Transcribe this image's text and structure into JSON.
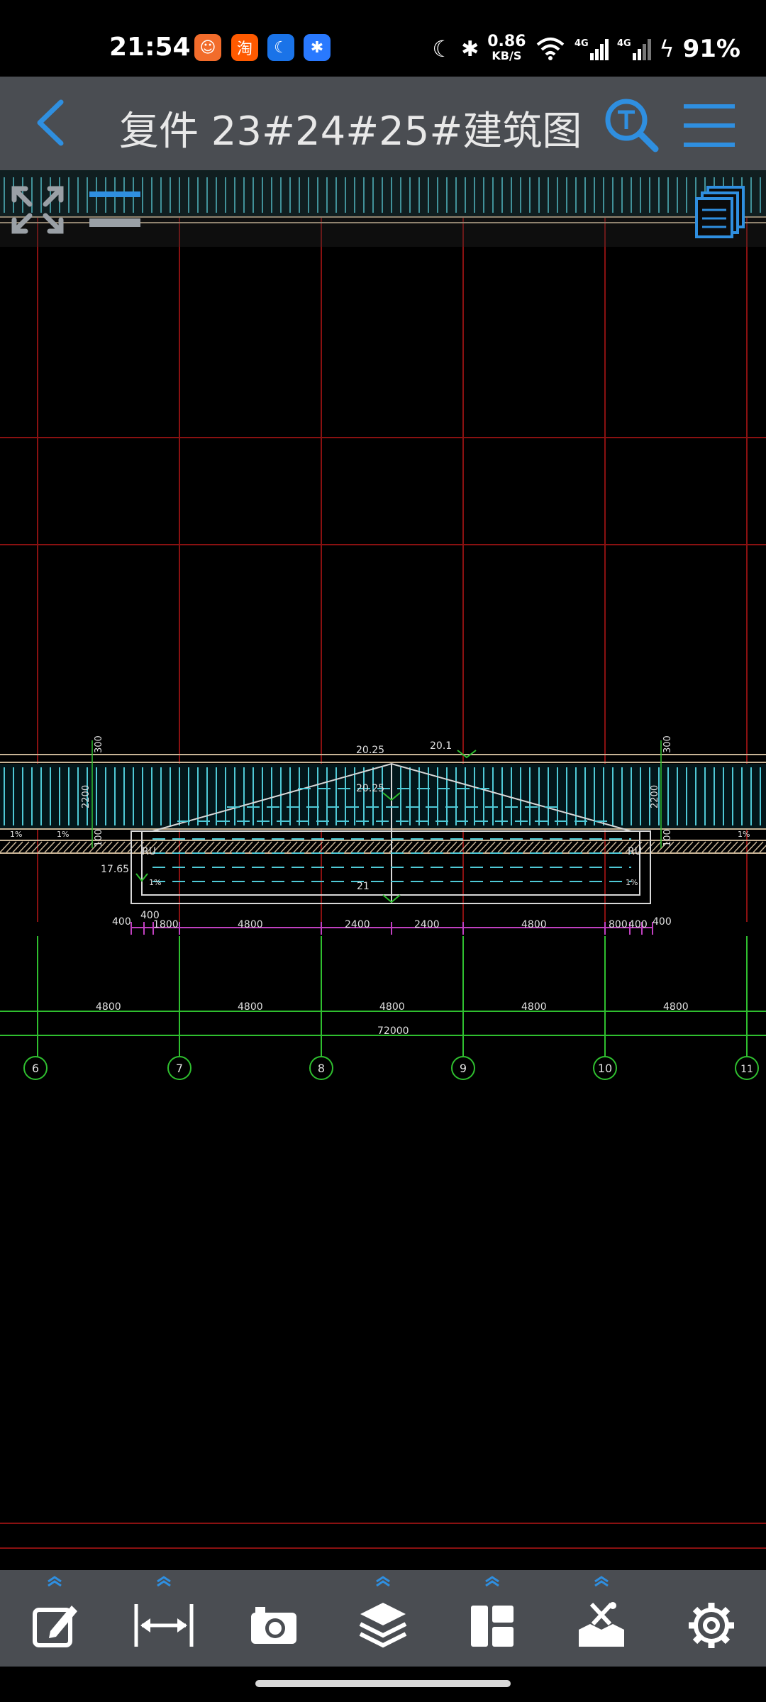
{
  "status_bar": {
    "time": "21:54",
    "apps": [
      {
        "name": "bilibili-app-icon",
        "color": "#f26c2b",
        "glyph": "☺"
      },
      {
        "name": "taobao-app-icon",
        "color": "#ff5a00",
        "glyph": "淘"
      },
      {
        "name": "sleep-app-icon",
        "color": "#1a73e8",
        "glyph": "☾"
      },
      {
        "name": "bluetooth-app-icon",
        "color": "#2979ff",
        "glyph": "✱"
      }
    ],
    "net_speed_value": "0.86",
    "net_speed_unit": "KB/S",
    "battery": "91%"
  },
  "title_bar": {
    "title": "复件 23#24#25#建筑图"
  },
  "drawing": {
    "elevation_labels": [
      "20.25",
      "20.1",
      "20.25",
      "17.65",
      "21"
    ],
    "vertical_dims": [
      "300",
      "2200",
      "100",
      "300",
      "2200",
      "100"
    ],
    "detail_dims": [
      "400",
      "400",
      "1800",
      "4800",
      "2400",
      "2400",
      "4800",
      "800",
      "400",
      "400"
    ],
    "bay_dims": [
      "4800",
      "4800",
      "4800",
      "4800",
      "4800"
    ],
    "overall_dim": "72000",
    "axis_labels": [
      "6",
      "7",
      "8",
      "9",
      "10",
      "11"
    ],
    "slope_marks": [
      "1%",
      "1%",
      "1%",
      "1%",
      "1%"
    ],
    "ru_labels": [
      "RU",
      "RU"
    ]
  },
  "toolbar": {
    "items": [
      "edit-icon",
      "measure-icon",
      "camera-icon",
      "layers-icon",
      "layout-icon",
      "tools-icon",
      "settings-icon"
    ]
  },
  "colors": {
    "accent": "#2f8fe0",
    "toolbar_bg": "#4a4d52",
    "grid_red": "#8a1111",
    "dim_green": "#2fbf2f",
    "dim_magenta": "#c040c0",
    "hatch_cyan": "#4fc9d6"
  }
}
